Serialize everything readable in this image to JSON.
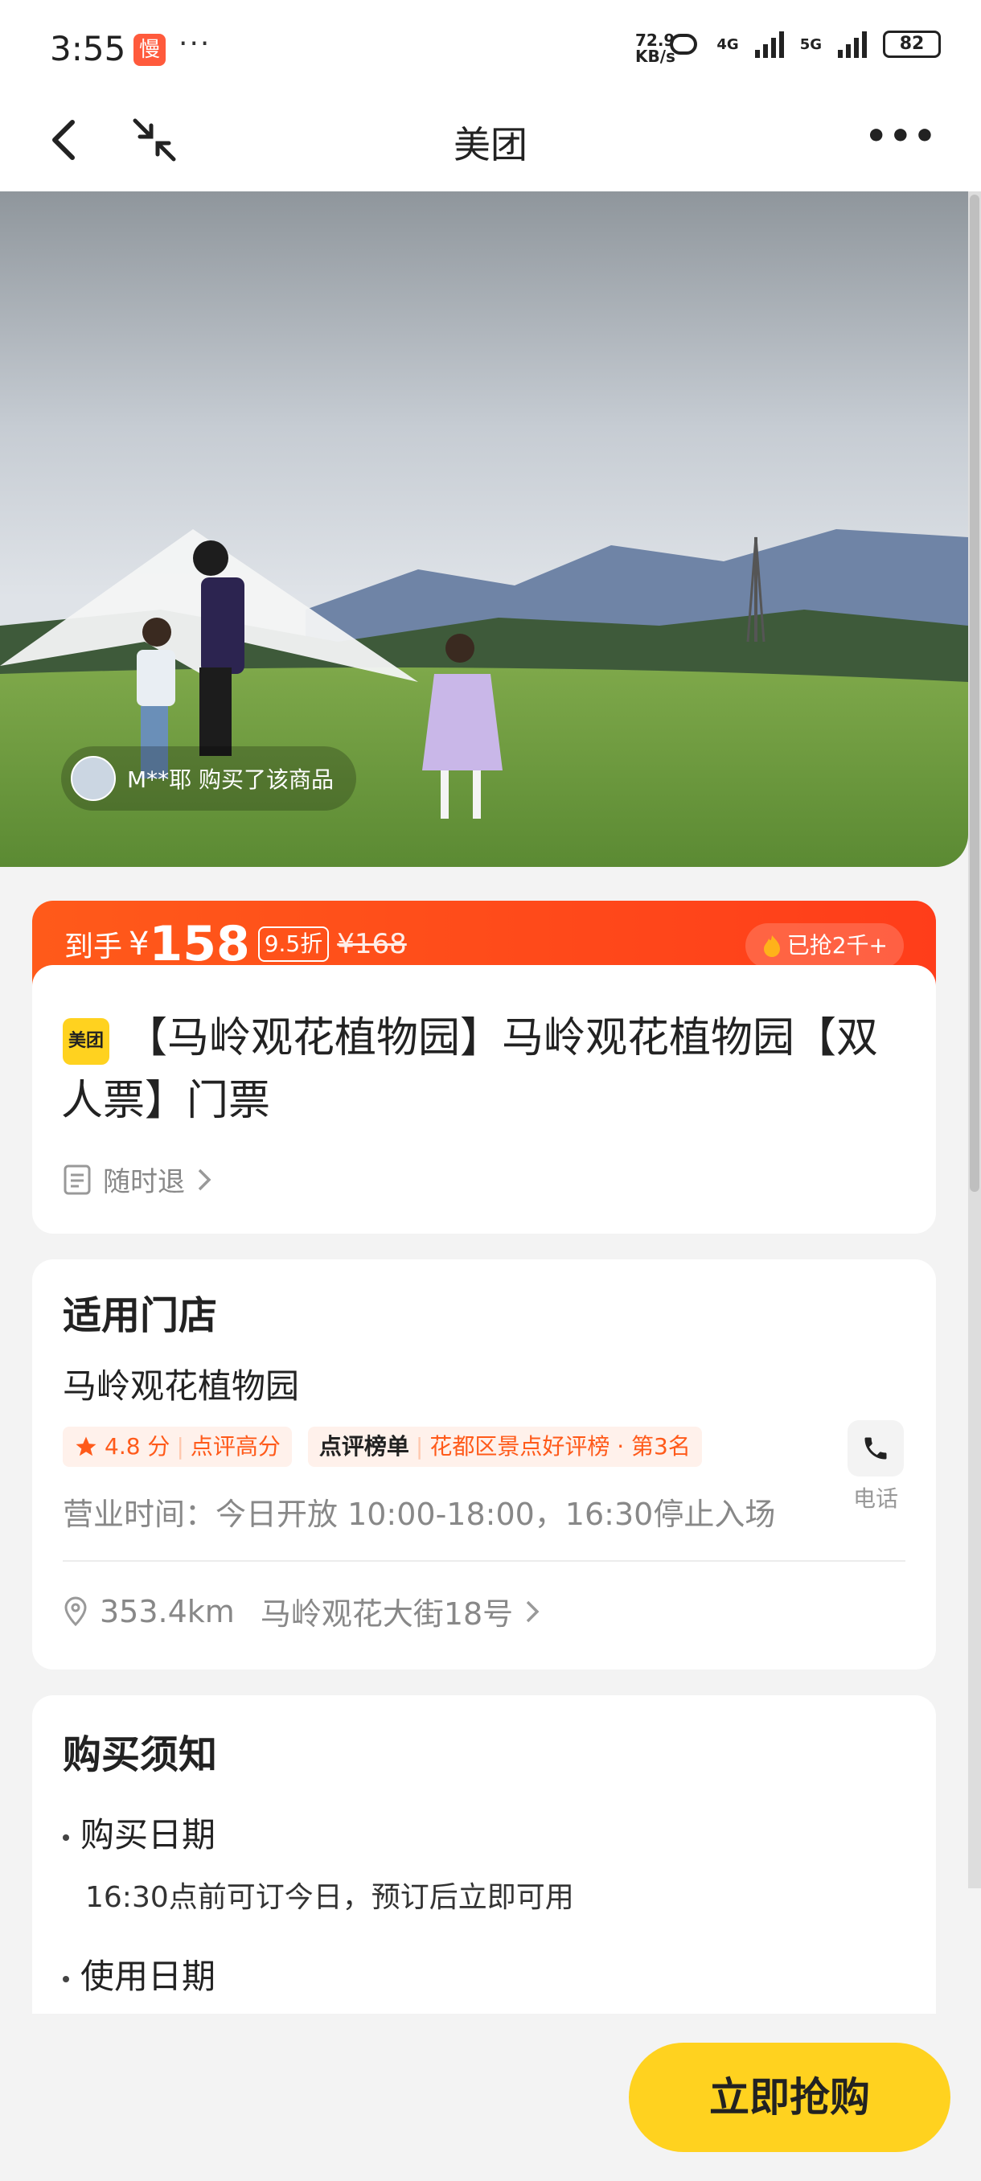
{
  "status_bar": {
    "time": "3:55",
    "app_badge": "慢",
    "dots": "···",
    "net_speed_value": "72.9",
    "net_speed_unit": "KB/s",
    "network_1": "4G",
    "network_2": "5G",
    "battery": "82"
  },
  "nav": {
    "title": "美团",
    "back_icon": "chevron-left-icon",
    "shrink_icon": "collapse-arrows-icon",
    "more": "•••"
  },
  "hero": {
    "buyer_text": "M**耶 购买了该商品"
  },
  "price_bar": {
    "label": "到手",
    "currency": "¥",
    "price": "158",
    "discount": "9.5折",
    "original": "¥168",
    "sold": "已抢2千+",
    "sold_icon": "flame-icon"
  },
  "product": {
    "brand": "美团",
    "title": "【马岭观花植物园】马岭观花植物园【双人票】门票",
    "refund": "随时退"
  },
  "store": {
    "heading": "适用门店",
    "name": "马岭观花植物园",
    "rating": "4.8 分",
    "rating_label": "点评高分",
    "rank_brand": "点评榜单",
    "rank_text": "花都区景点好评榜 · 第3名",
    "hours": "营业时间：今日开放 10:00-18:00，16:30停止入场",
    "phone_label": "电话",
    "distance": "353.4km",
    "address": "马岭观花大街18号"
  },
  "notice": {
    "heading": "购买须知",
    "items": [
      {
        "title": "购买日期",
        "desc": "16:30点前可订今日，预订后立即可用"
      },
      {
        "title": "使用日期",
        "desc": ""
      }
    ]
  },
  "footer": {
    "buy_label": "立即抢购"
  },
  "colors": {
    "accent": "#ff4e1a",
    "brand_yellow": "#ffd21f"
  }
}
